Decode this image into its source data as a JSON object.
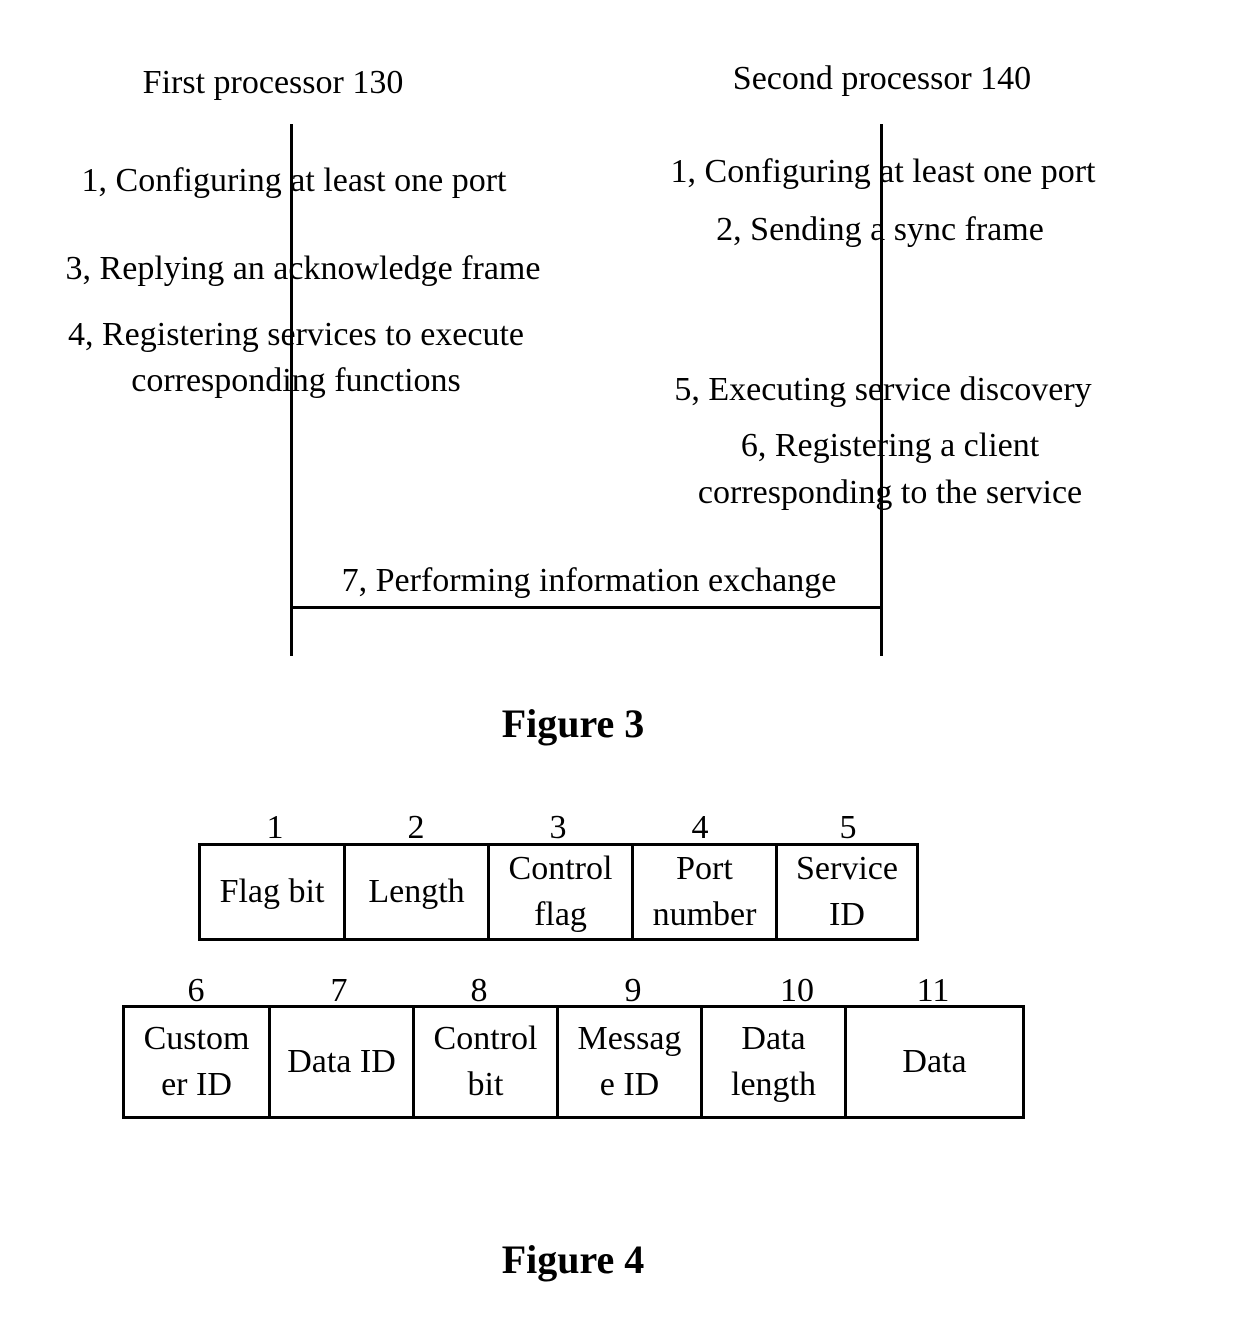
{
  "figure3": {
    "title": "Figure 3",
    "participants": {
      "first": "First processor 130",
      "second": "Second processor 140"
    },
    "first_steps": [
      "1, Configuring at least one port",
      "3, Replying an acknowledge frame",
      "4, Registering services to execute",
      "corresponding functions"
    ],
    "second_steps": [
      "1, Configuring at least one port",
      "2, Sending a sync frame",
      "5, Executing service discovery",
      "6, Registering a client",
      "corresponding to the service"
    ],
    "exchange": "7, Performing information exchange"
  },
  "figure4": {
    "title": "Figure 4",
    "row1": [
      {
        "index": "1",
        "line1": "Flag bit",
        "line2": ""
      },
      {
        "index": "2",
        "line1": "Length",
        "line2": ""
      },
      {
        "index": "3",
        "line1": "Control",
        "line2": "flag"
      },
      {
        "index": "4",
        "line1": "Port",
        "line2": "number"
      },
      {
        "index": "5",
        "line1": "Service",
        "line2": "ID"
      }
    ],
    "row2": [
      {
        "index": "6",
        "line1": "Custom",
        "line2": "er ID"
      },
      {
        "index": "7",
        "line1": "Data ID",
        "line2": ""
      },
      {
        "index": "8",
        "line1": "Control",
        "line2": "bit"
      },
      {
        "index": "9",
        "line1": "Messag",
        "line2": "e ID"
      },
      {
        "index": "10",
        "line1": "Data",
        "line2": "length"
      },
      {
        "index": "11",
        "line1": "Data",
        "line2": ""
      }
    ]
  }
}
